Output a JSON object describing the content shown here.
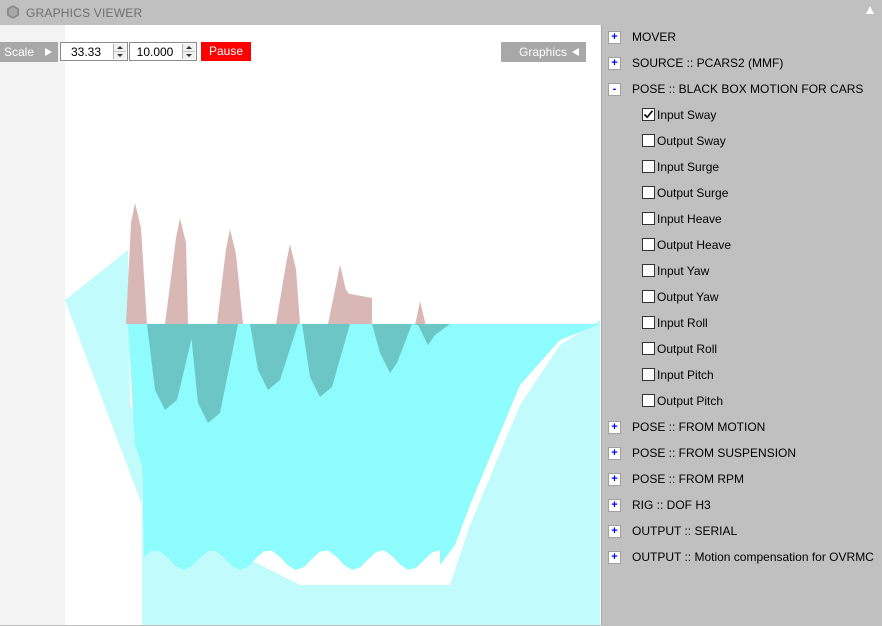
{
  "window": {
    "title": "GRAPHICS VIEWER"
  },
  "controls": {
    "scale_label": "Scale",
    "value1": "33.33",
    "value2": "10.000",
    "pause_label": "Pause",
    "graphics_label": "Graphics"
  },
  "colors": {
    "pause_bg": "#ff0000",
    "input_fill": "#d9b7b5",
    "output_fill": "#8efcfc",
    "output_dark": "#6cc6c6",
    "light_cyan": "#c1fbfb"
  },
  "tree": {
    "sections": [
      {
        "label": "MOVER",
        "expander": "+"
      },
      {
        "label": "SOURCE :: PCARS2 (MMF)",
        "expander": "+"
      },
      {
        "label": "POSE :: BLACK BOX MOTION FOR CARS",
        "expander": "-",
        "children": [
          {
            "label": "Input Sway",
            "checked": true
          },
          {
            "label": "Output Sway",
            "checked": false
          },
          {
            "label": "Input Surge",
            "checked": false
          },
          {
            "label": "Output Surge",
            "checked": false
          },
          {
            "label": "Input Heave",
            "checked": false
          },
          {
            "label": "Output Heave",
            "checked": false
          },
          {
            "label": "Input Yaw",
            "checked": false
          },
          {
            "label": "Output Yaw",
            "checked": false
          },
          {
            "label": "Input Roll",
            "checked": false
          },
          {
            "label": "Output Roll",
            "checked": false
          },
          {
            "label": "Input Pitch",
            "checked": false
          },
          {
            "label": "Output Pitch",
            "checked": false
          }
        ]
      },
      {
        "label": "POSE :: FROM MOTION",
        "expander": "+"
      },
      {
        "label": "POSE :: FROM SUSPENSION",
        "expander": "+"
      },
      {
        "label": "POSE :: FROM RPM",
        "expander": "+"
      },
      {
        "label": "RIG :: DOF H3",
        "expander": "+"
      },
      {
        "label": "OUTPUT :: SERIAL",
        "expander": "+"
      },
      {
        "label": "OUTPUT :: Motion compensation for OVRMC",
        "expander": "+"
      }
    ]
  }
}
